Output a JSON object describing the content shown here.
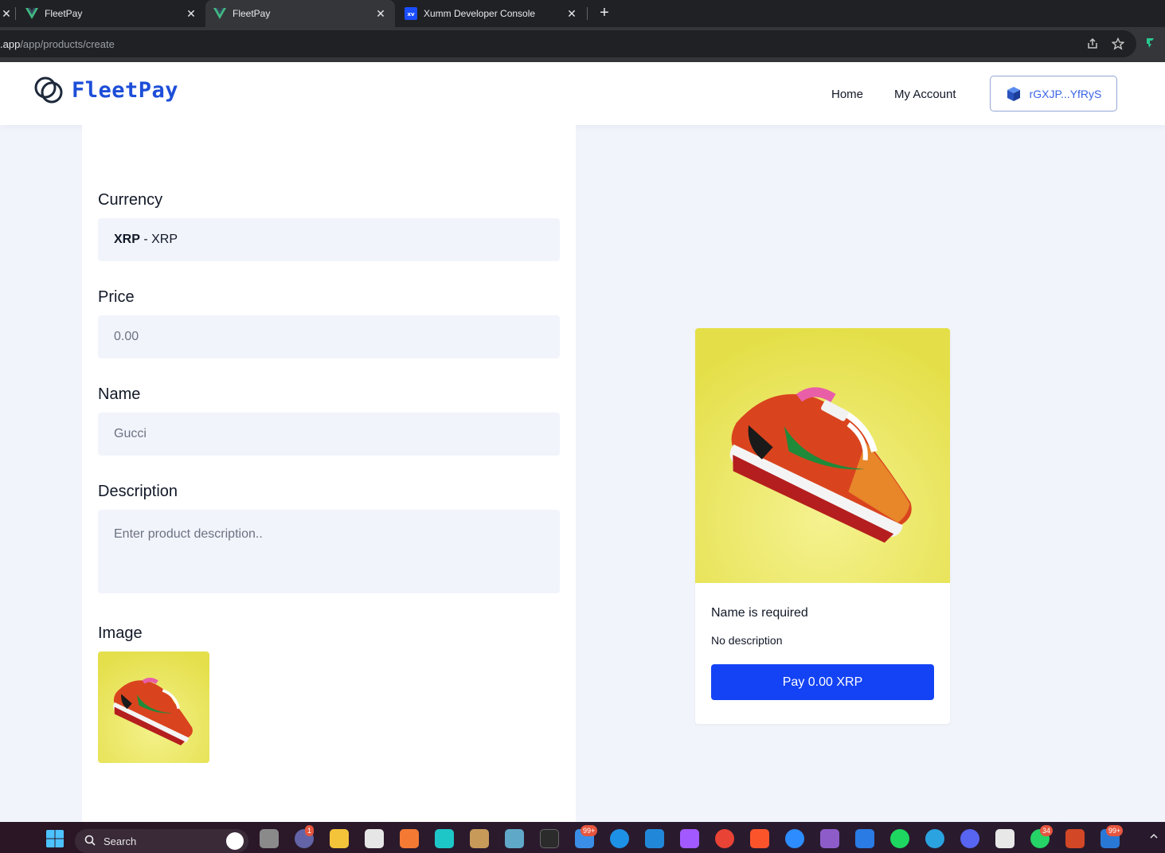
{
  "browser": {
    "tabs": [
      {
        "title": "FleetPay",
        "favicon": "vue-icon"
      },
      {
        "title": "FleetPay",
        "favicon": "vue-icon"
      },
      {
        "title": "Xumm Developer Console",
        "favicon": "xumm-icon"
      }
    ],
    "url_host": ".app",
    "url_path": "/app/products/create",
    "close_glyph": "✕",
    "new_tab_glyph": "+"
  },
  "header": {
    "brand": "FleetPay",
    "nav": [
      "Home",
      "My Account"
    ],
    "wallet_address": "rGXJP...YfRyS"
  },
  "form": {
    "currency_label": "Currency",
    "currency_code": "XRP",
    "currency_sep": " - ",
    "currency_name": "XRP",
    "price_label": "Price",
    "price_placeholder": "0.00",
    "name_label": "Name",
    "name_value": "Gucci",
    "description_label": "Description",
    "description_placeholder": "Enter product description..",
    "image_label": "Image"
  },
  "preview": {
    "name": "Name is required",
    "description": "No description",
    "pay_label": "Pay 0.00 XRP"
  },
  "taskbar": {
    "search_label": "Search",
    "badges": [
      "1",
      "99+",
      "34",
      "99+"
    ]
  },
  "colors": {
    "brand_blue": "#1d4ed8",
    "pay_button": "#1443f5",
    "page_bg": "#f1f4fb",
    "input_bg": "#f1f4fb"
  }
}
